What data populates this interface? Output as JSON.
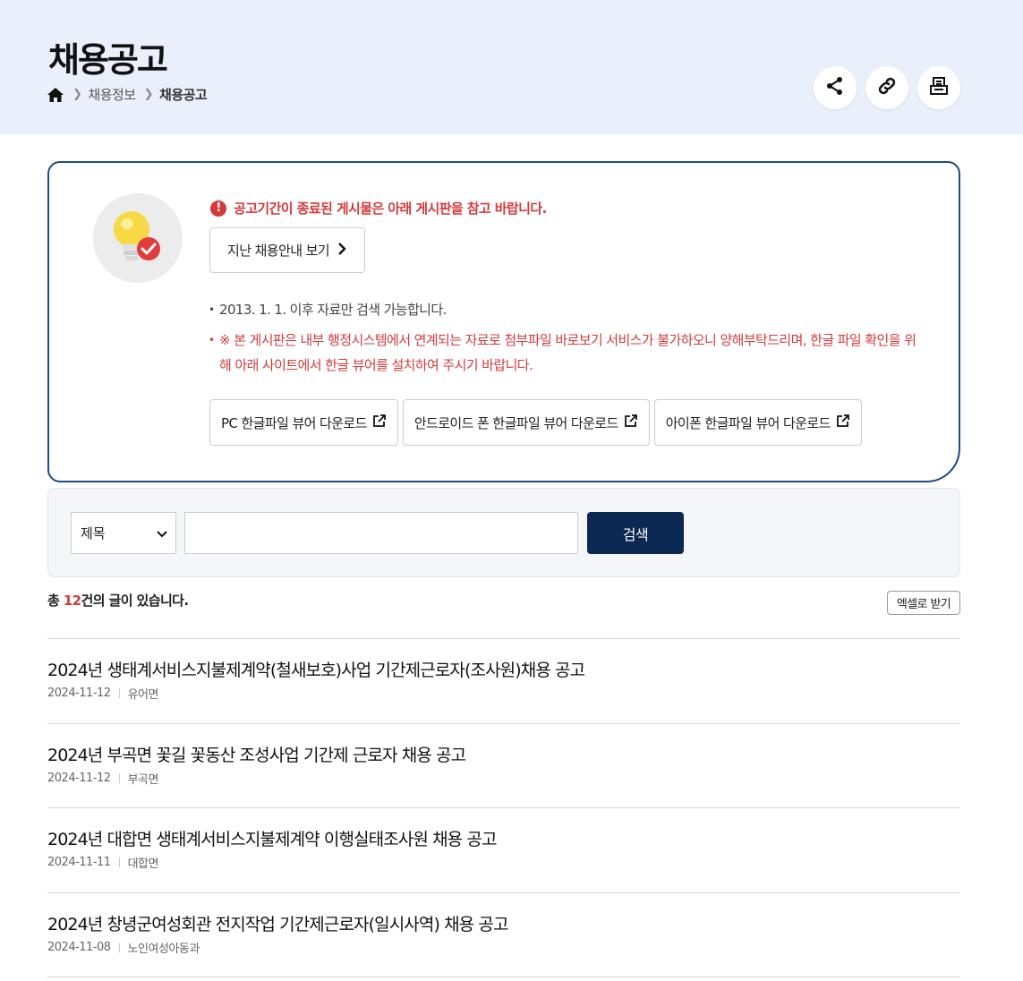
{
  "header": {
    "title": "채용공고",
    "breadcrumb": [
      "채용정보",
      "채용공고"
    ]
  },
  "tools": {
    "icons": [
      "share-icon",
      "link-icon",
      "print-icon"
    ]
  },
  "notice": {
    "alert": "공고기간이 종료된 게시물은 아래 게시판을 참고 바랍니다.",
    "past_button": "지난 채용안내 보기",
    "items": [
      "2013. 1. 1. 이후 자료만 검색 가능합니다.",
      "※ 본 게시판은 내부 행정시스템에서 연계되는 자료로 첨부파일 바로보기 서비스가 불가하오니 양해부탁드리며, 한글 파일 확인을 위해 아래 사이트에서 한글 뷰어를 설치하여 주시기 바랍니다."
    ],
    "downloads": [
      "PC 한글파일 뷰어 다운로드",
      "안드로이드 폰 한글파일 뷰어 다운로드",
      "아이폰 한글파일 뷰어 다운로드"
    ]
  },
  "search": {
    "field": "제목",
    "query": "",
    "button": "검색"
  },
  "summary": {
    "prefix": "총 ",
    "count": "12",
    "suffix": "건의 글이 있습니다."
  },
  "excel_button": "엑셀로 받기",
  "posts": [
    {
      "title": "2024년 생태계서비스지불제계약(철새보호)사업 기간제근로자(조사원)채용 공고",
      "date": "2024-11-12",
      "dept": "유어면"
    },
    {
      "title": "2024년 부곡면 꽃길 꽃동산 조성사업 기간제 근로자 채용 공고",
      "date": "2024-11-12",
      "dept": "부곡면"
    },
    {
      "title": "2024년 대합면 생태계서비스지불제계약 이행실태조사원 채용 공고",
      "date": "2024-11-11",
      "dept": "대합면"
    },
    {
      "title": "2024년 창녕군여성회관 전지작업 기간제근로자(일시사역) 채용 공고",
      "date": "2024-11-08",
      "dept": "노인여성아동과"
    }
  ],
  "colors": {
    "header_bg": "#eaf0fb",
    "accent_red": "#d43a3a",
    "navy": "#0c2954",
    "notice_border": "#1e4b8a"
  }
}
